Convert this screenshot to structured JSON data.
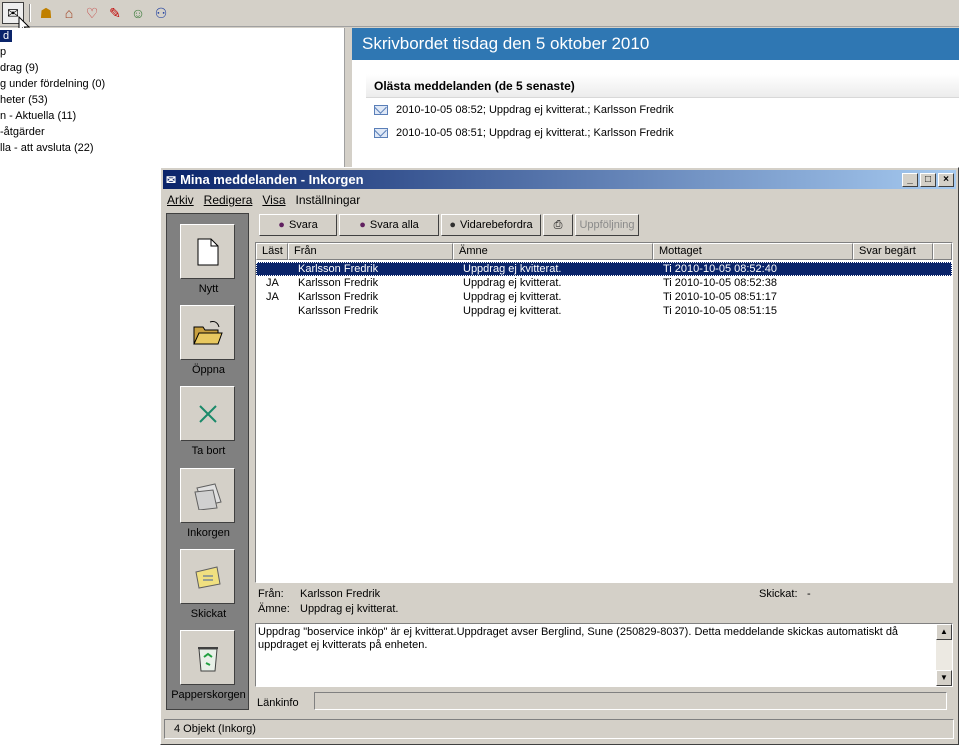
{
  "toolbar": {
    "icons": [
      "mail-icon",
      "group-icon",
      "house-icon",
      "heart-icon",
      "pen-icon",
      "person-icon",
      "people-icon"
    ]
  },
  "tree": {
    "items": [
      {
        "label": "d",
        "selected": true
      },
      {
        "label": "p"
      },
      {
        "label": "drag (9)"
      },
      {
        "label": "g under fördelning (0)"
      },
      {
        "label": "heter (53)"
      },
      {
        "label": "n - Aktuella (11)"
      },
      {
        "label": "-åtgärder"
      },
      {
        "label": "lla - att avsluta (22)"
      }
    ]
  },
  "desktop": {
    "title": "Skrivbordet tisdag den 5 oktober 2010",
    "unread_heading": "Olästa meddelanden (de 5 senaste)",
    "unread": [
      "2010-10-05 08:52; Uppdrag ej kvitterat.; Karlsson Fredrik",
      "2010-10-05 08:51; Uppdrag ej kvitterat.; Karlsson Fredrik"
    ]
  },
  "window": {
    "title": "Mina meddelanden - Inkorgen",
    "controls": {
      "minimize": "_",
      "maximize": "□",
      "close": "×"
    },
    "menu": {
      "arkiv": "Arkiv",
      "redigera": "Redigera",
      "visa": "Visa",
      "installningar": "Inställningar"
    },
    "sidebar": {
      "nytt": "Nytt",
      "oppna": "Öppna",
      "tabort": "Ta bort",
      "inkorgen": "Inkorgen",
      "skickat": "Skickat",
      "papperskorgen": "Papperskorgen"
    },
    "actions": {
      "svara": "Svara",
      "svara_alla": "Svara alla",
      "vidarebefordra": "Vidarebefordra",
      "uppfoljning": "Uppföljning"
    },
    "columns": {
      "last": "Läst",
      "fran": "Från",
      "amne": "Ämne",
      "mottaget": "Mottaget",
      "svar": "Svar begärt"
    },
    "rows": [
      {
        "last": "",
        "fran": "Karlsson Fredrik",
        "amne": "Uppdrag ej kvitterat.",
        "mottaget": "Ti 2010-10-05 08:52:40",
        "svar": "",
        "selected": true
      },
      {
        "last": "JA",
        "fran": "Karlsson Fredrik",
        "amne": "Uppdrag ej kvitterat.",
        "mottaget": "Ti 2010-10-05 08:52:38",
        "svar": ""
      },
      {
        "last": "JA",
        "fran": "Karlsson Fredrik",
        "amne": "Uppdrag ej kvitterat.",
        "mottaget": "Ti 2010-10-05 08:51:17",
        "svar": ""
      },
      {
        "last": "",
        "fran": "Karlsson Fredrik",
        "amne": "Uppdrag ej kvitterat.",
        "mottaget": "Ti 2010-10-05 08:51:15",
        "svar": ""
      }
    ],
    "detail": {
      "from_label": "Från:",
      "from_value": "Karlsson Fredrik",
      "sent_label": "Skickat:",
      "sent_value": "-",
      "subject_label": "Ämne:",
      "subject_value": "Uppdrag ej kvitterat.",
      "body": "Uppdrag \"boservice inköp\" är ej kvitterat.Uppdraget avser Berglind, Sune (250829-8037). Detta meddelande skickas automatiskt då uppdraget ej kvitterats på enheten.",
      "linkinfo_label": "Länkinfo"
    },
    "status": "4 Objekt (Inkorg)"
  }
}
